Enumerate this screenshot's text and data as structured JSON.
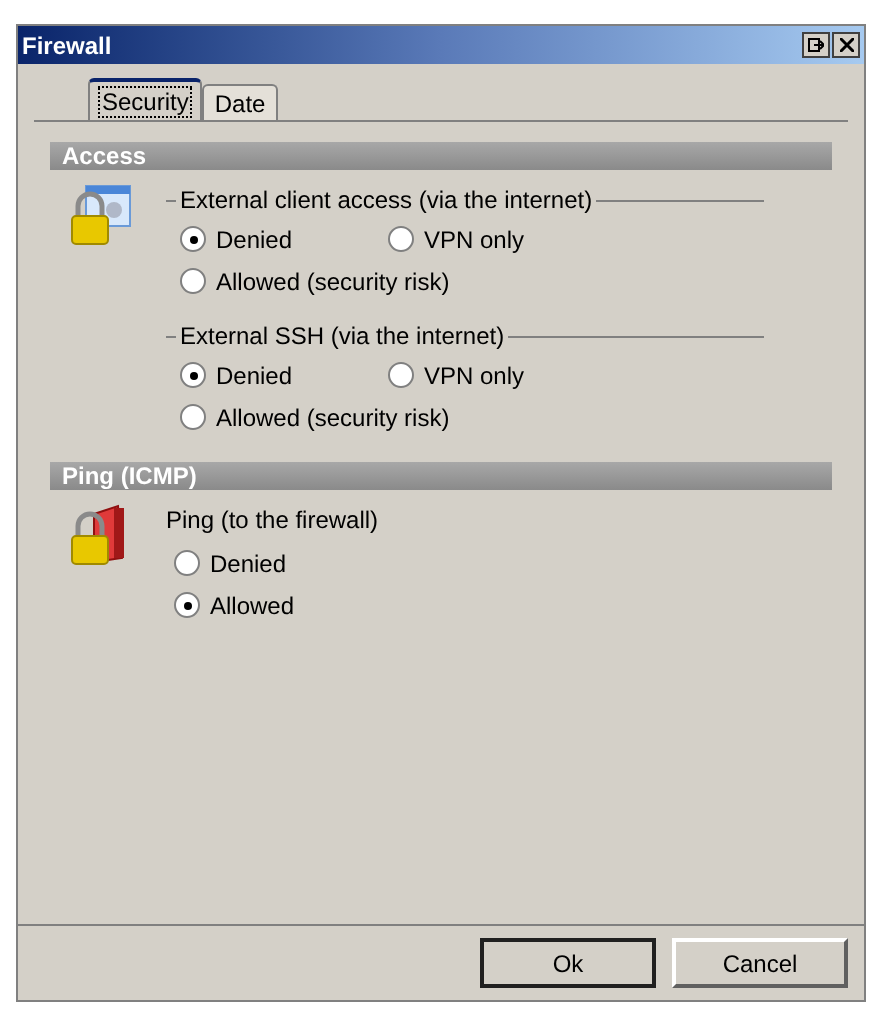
{
  "window": {
    "title": "Firewall"
  },
  "tabs": [
    {
      "label": "Security",
      "selected": true
    },
    {
      "label": "Date",
      "selected": false
    }
  ],
  "sections": [
    {
      "title": "Access",
      "kind": "access",
      "groups": [
        {
          "label": "External client access (via the internet)",
          "kind": "framed",
          "options": [
            {
              "label": "Denied",
              "selected": true
            },
            {
              "label": "VPN only",
              "selected": false
            },
            {
              "label": "Allowed (security risk)",
              "selected": false
            }
          ]
        },
        {
          "label": "External SSH (via the internet)",
          "kind": "framed",
          "options": [
            {
              "label": "Denied",
              "selected": true
            },
            {
              "label": "VPN only",
              "selected": false
            },
            {
              "label": "Allowed (security risk)",
              "selected": false
            }
          ]
        }
      ]
    },
    {
      "title": "Ping (ICMP)",
      "kind": "ping",
      "groups": [
        {
          "label": "Ping (to the firewall)",
          "kind": "plain",
          "options": [
            {
              "label": "Denied",
              "selected": false
            },
            {
              "label": "Allowed",
              "selected": true
            }
          ]
        }
      ]
    }
  ],
  "buttons": [
    {
      "label": "Ok",
      "default": true
    },
    {
      "label": "Cancel",
      "default": false
    }
  ]
}
